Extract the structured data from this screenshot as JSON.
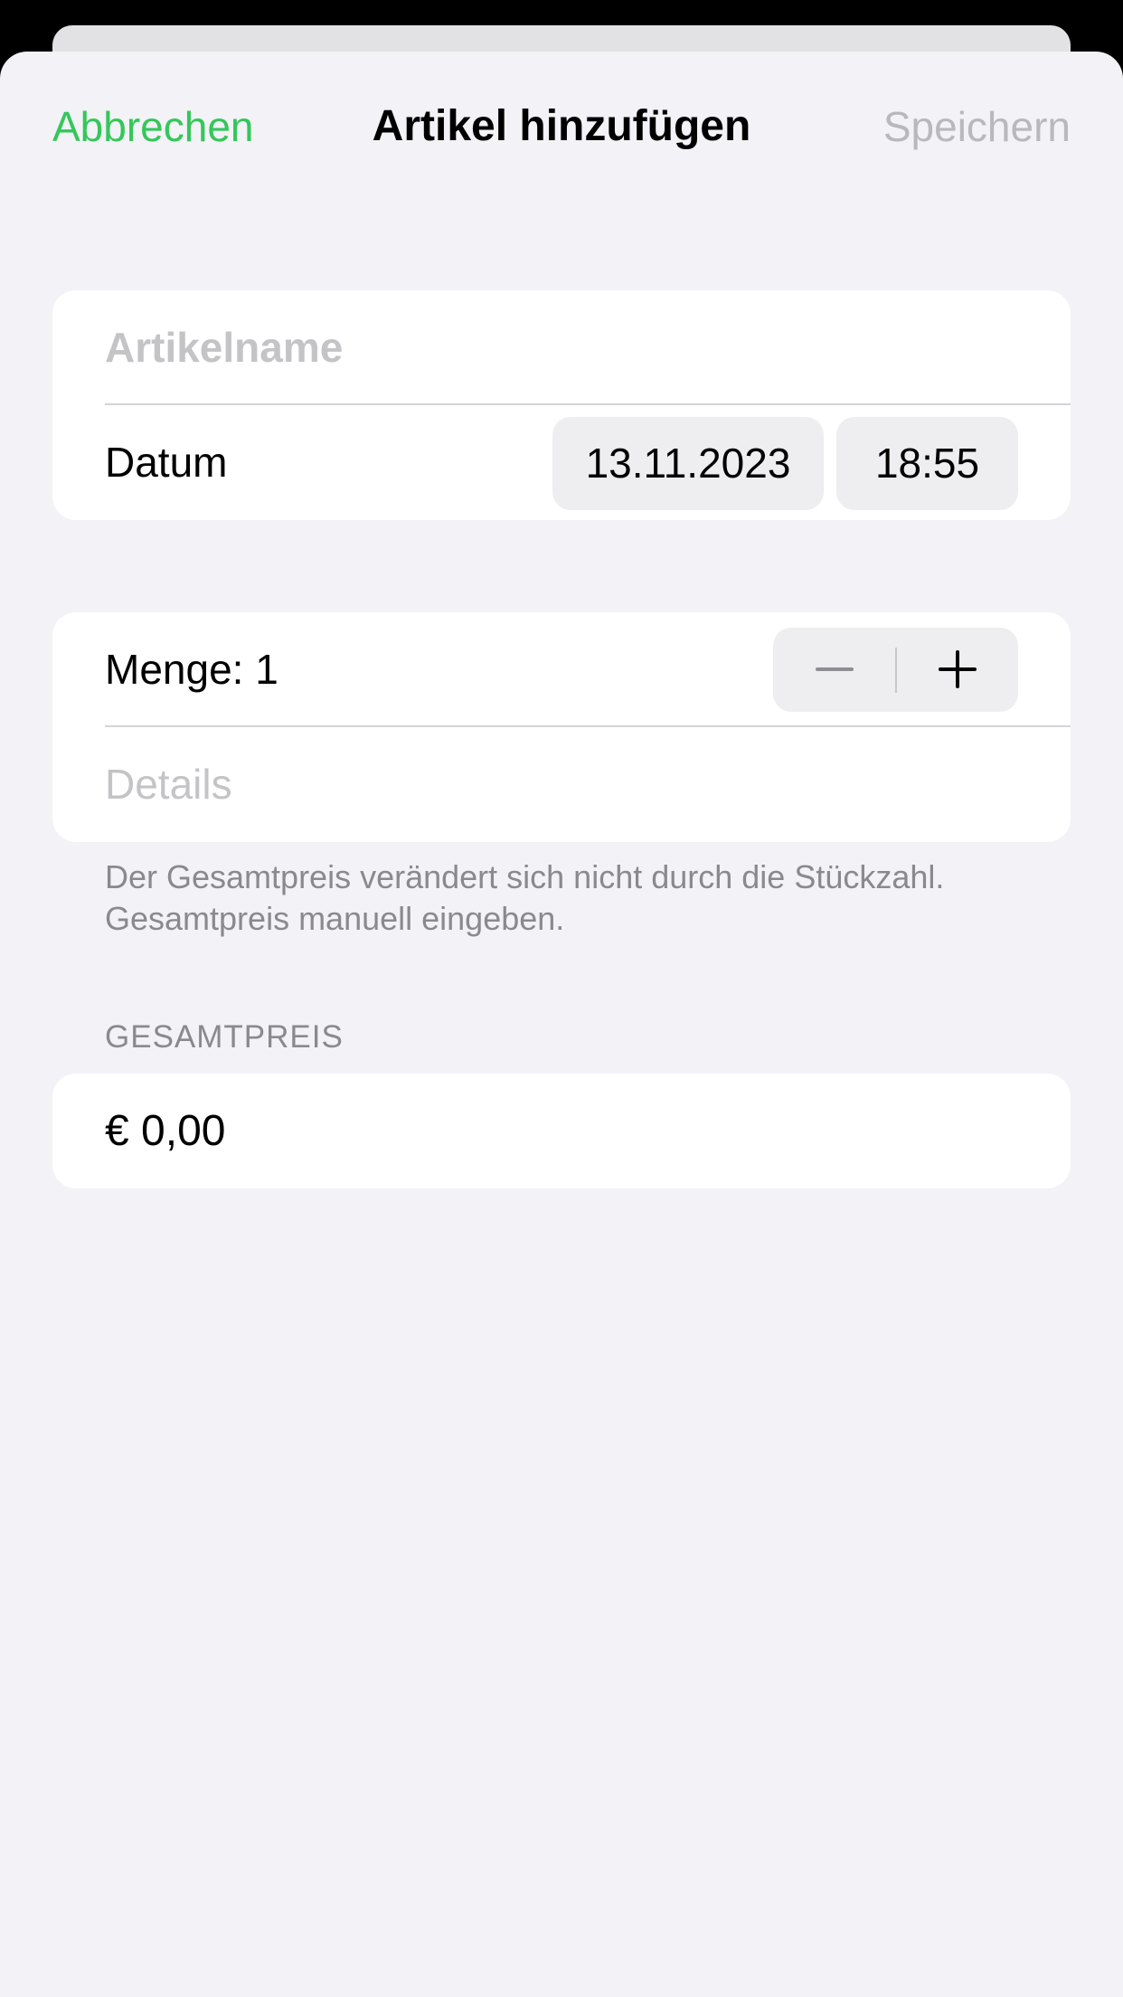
{
  "nav": {
    "cancel_label": "Abbrechen",
    "title": "Artikel hinzufügen",
    "save_label": "Speichern"
  },
  "form": {
    "name_placeholder": "Artikelname",
    "date_label": "Datum",
    "date_value": "13.11.2023",
    "time_value": "18:55",
    "quantity_label": "Menge: 1",
    "quantity": 1,
    "details_placeholder": "Details",
    "footer_note": "Der Gesamtpreis verändert sich nicht durch die Stückzahl. Gesamtpreis manuell eingeben.",
    "price_section_header": "GESAMTPREIS",
    "price_value": "€ 0,00"
  },
  "icons": {
    "decrement": "minus-icon",
    "increment": "plus-icon"
  },
  "colors": {
    "accent": "#34c759",
    "disabled": "#b8b8bd",
    "background": "#f2f2f7",
    "placeholder": "#c4c4c7",
    "secondary_text": "#8a8a8e"
  }
}
